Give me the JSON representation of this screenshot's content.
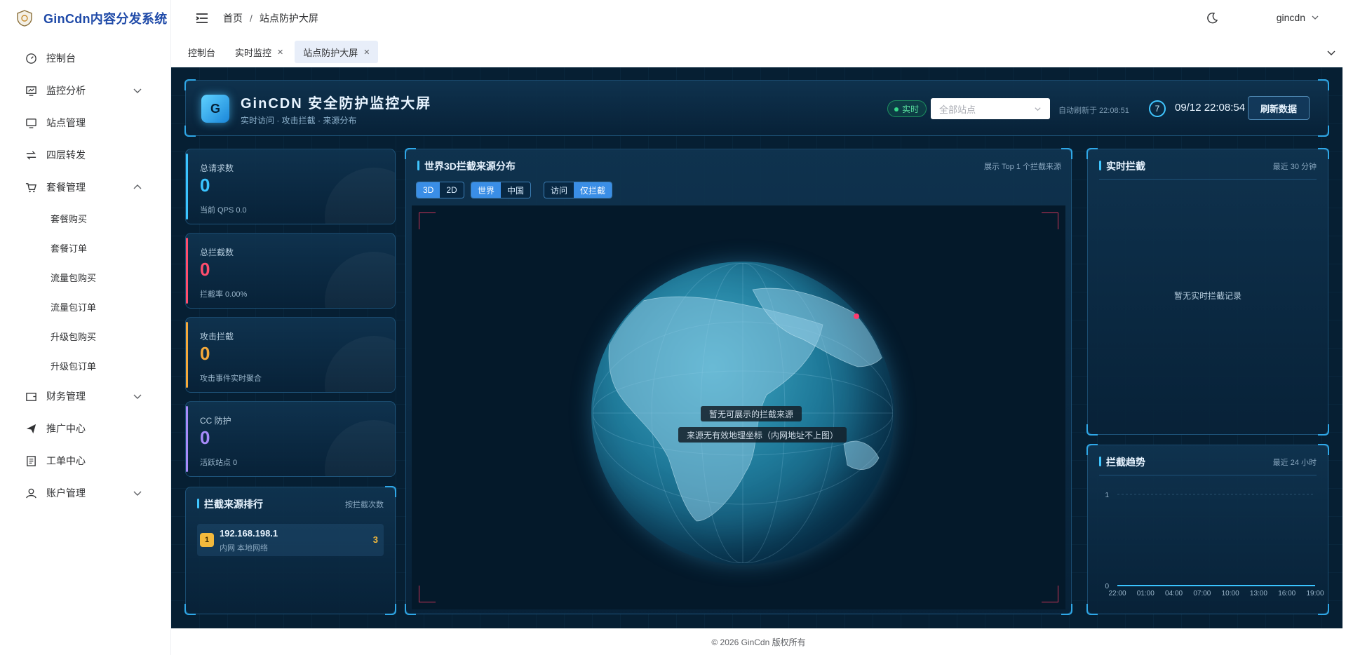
{
  "app": {
    "title": "GinCdn内容分发系统"
  },
  "sidebar": {
    "items": [
      {
        "label": "控制台",
        "icon": "dashboard-icon"
      },
      {
        "label": "监控分析",
        "icon": "monitor-chart-icon",
        "expandable": true
      },
      {
        "label": "站点管理",
        "icon": "monitor-icon"
      },
      {
        "label": "四层转发",
        "icon": "forward-icon"
      },
      {
        "label": "套餐管理",
        "icon": "cart-icon",
        "expanded": true
      },
      {
        "label": "财务管理",
        "icon": "wallet-icon",
        "expandable": true
      },
      {
        "label": "推广中心",
        "icon": "send-icon"
      },
      {
        "label": "工单中心",
        "icon": "ticket-icon"
      },
      {
        "label": "账户管理",
        "icon": "user-icon",
        "expandable": true
      }
    ],
    "package_sub": [
      "套餐购买",
      "套餐订单",
      "流量包购买",
      "流量包订单",
      "升级包购买",
      "升级包订单"
    ]
  },
  "breadcrumb": {
    "home": "首页",
    "current": "站点防护大屏"
  },
  "user": {
    "name": "gincdn"
  },
  "tags": [
    {
      "label": "控制台",
      "closable": false
    },
    {
      "label": "实时监控",
      "closable": true
    },
    {
      "label": "站点防护大屏",
      "closable": true,
      "active": true
    }
  ],
  "header": {
    "logo_letter": "G",
    "title": "GinCDN 安全防护监控大屏",
    "subtitle": "实时访问 · 攻击拦截 · 来源分布",
    "live_label": "实时",
    "site_select_placeholder": "全部站点",
    "auto_refresh": "自动刷新于 22:08:51",
    "countdown": "7",
    "clock": "09/12 22:08:54",
    "refresh_button": "刷新数据"
  },
  "stats": [
    {
      "label": "总请求数",
      "value": "0",
      "sub": "当前 QPS 0.0",
      "color": "#3ac4ff"
    },
    {
      "label": "总拦截数",
      "value": "0",
      "sub": "拦截率 0.00%",
      "color": "#ff4d6d"
    },
    {
      "label": "攻击拦截",
      "value": "0",
      "sub": "攻击事件实时聚合",
      "color": "#f5a93a"
    },
    {
      "label": "CC 防护",
      "value": "0",
      "sub": "活跃站点 0",
      "color": "#a78bfa"
    }
  ],
  "ranking": {
    "title": "拦截来源排行",
    "meta": "按拦截次数",
    "rows": [
      {
        "rank": "1",
        "ip": "192.168.198.1",
        "location": "内网 本地网络",
        "count": "3"
      }
    ]
  },
  "globe": {
    "title": "世界3D拦截来源分布",
    "meta": "展示 Top 1 个拦截来源",
    "dim_tabs": [
      "3D",
      "2D"
    ],
    "scope_tabs": [
      "世界",
      "中国"
    ],
    "type_tabs": [
      "访问",
      "仅拦截"
    ],
    "empty_primary": "暂无可展示的拦截来源",
    "empty_secondary": "来源无有效地理坐标（内网地址不上图）"
  },
  "realtime": {
    "title": "实时拦截",
    "meta": "最近 30 分钟",
    "empty": "暂无实时拦截记录"
  },
  "trend": {
    "title": "拦截趋势",
    "meta": "最近 24 小时"
  },
  "chart_data": {
    "type": "line",
    "x": [
      "22:00",
      "01:00",
      "04:00",
      "07:00",
      "10:00",
      "13:00",
      "16:00",
      "19:00"
    ],
    "series": [
      {
        "values": [
          0,
          0,
          0,
          0,
          0,
          0,
          0,
          0
        ],
        "color": "#3ac4ff"
      }
    ],
    "ylim": [
      0,
      1
    ],
    "yticks": [
      "0",
      "1"
    ],
    "grid": true
  },
  "footer": {
    "copyright": "© 2026 GinCdn 版权所有"
  }
}
